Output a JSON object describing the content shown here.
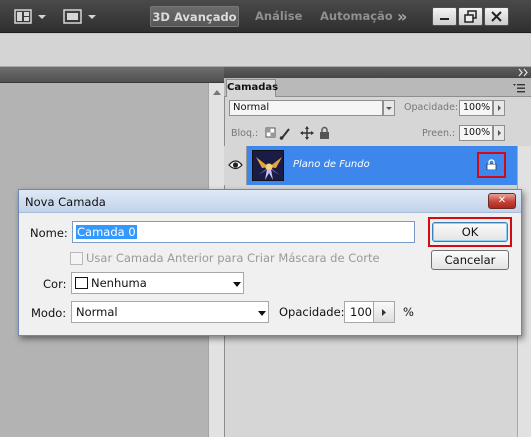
{
  "menubar": {
    "workspaces": [
      "3D Avançado",
      "Análise",
      "Automação"
    ],
    "overflow_glyph": "»",
    "icons": [
      "arrange-documents-icon",
      "screen-mode-icon",
      "minimize-icon",
      "restore-icon",
      "close-icon"
    ]
  },
  "panel": {
    "tab_label": "Camadas",
    "blend_mode": "Normal",
    "opacity_label": "Opacidade:",
    "opacity_value": "100%",
    "lock_label": "Bloq.:",
    "fill_label": "Preen.:",
    "fill_value": "100%",
    "layer": {
      "name": "Plano de Fundo",
      "visible": true,
      "locked": true
    }
  },
  "dialog": {
    "title": "Nova Camada",
    "close_glyph": "✕",
    "name_label": "Nome:",
    "name_value": "Camada 0",
    "clip_checkbox_label": "Usar Camada Anterior para Criar Máscara de Corte",
    "clip_checkbox_checked": false,
    "color_label": "Cor:",
    "color_value": "Nenhuma",
    "mode_label": "Modo:",
    "mode_value": "Normal",
    "opacity_label": "Opacidade:",
    "opacity_value": "100",
    "opacity_unit": "%",
    "ok_label": "OK",
    "cancel_label": "Cancelar"
  },
  "highlight_color": "#d40a12",
  "selection_color": "#3d87ec"
}
